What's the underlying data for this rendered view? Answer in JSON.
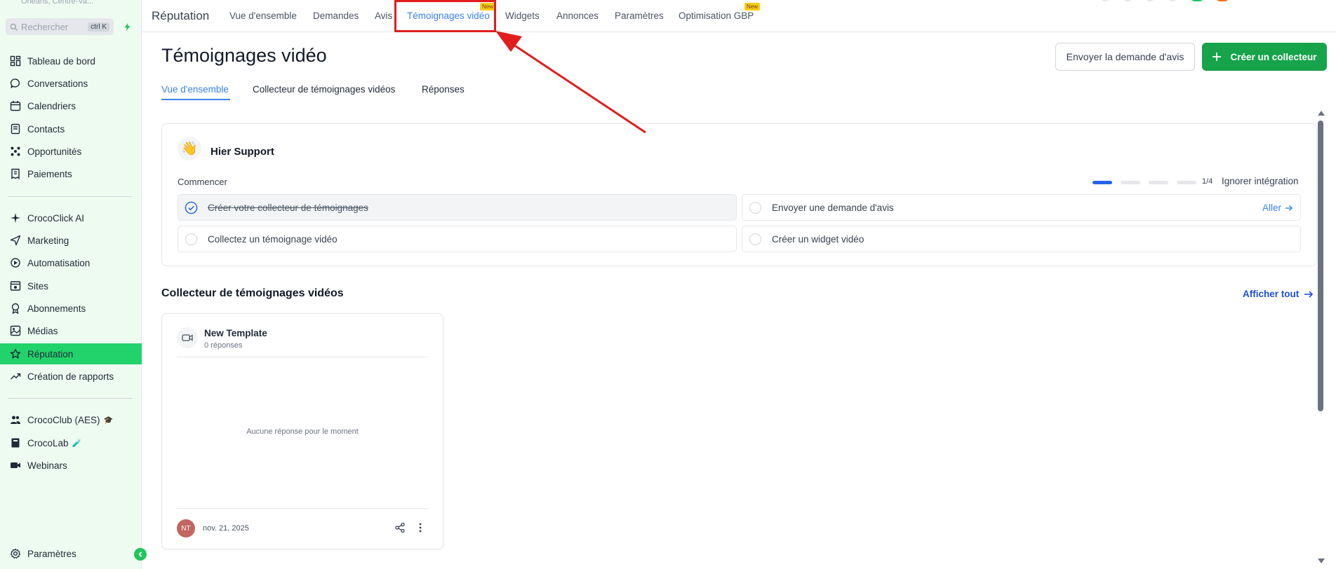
{
  "sidebar": {
    "location": "Orléans, Centre-Va...",
    "search_placeholder": "Rechercher",
    "search_shortcut": "ctrl K",
    "items": [
      {
        "label": "Tableau de bord",
        "icon": "dashboard-icon"
      },
      {
        "label": "Conversations",
        "icon": "chat-icon"
      },
      {
        "label": "Calendriers",
        "icon": "calendar-icon"
      },
      {
        "label": "Contacts",
        "icon": "contacts-icon"
      },
      {
        "label": "Opportunités",
        "icon": "pipeline-icon"
      },
      {
        "label": "Paiements",
        "icon": "receipt-icon"
      },
      {
        "label": "CrocoClick AI",
        "icon": "sparkle-icon"
      },
      {
        "label": "Marketing",
        "icon": "send-icon"
      },
      {
        "label": "Automatisation",
        "icon": "automation-icon"
      },
      {
        "label": "Sites",
        "icon": "site-icon"
      },
      {
        "label": "Abonnements",
        "icon": "award-icon"
      },
      {
        "label": "Médias",
        "icon": "image-icon"
      },
      {
        "label": "Réputation",
        "icon": "star-icon",
        "active": true
      },
      {
        "label": "Création de rapports",
        "icon": "trend-icon"
      },
      {
        "label": "CrocoClub (AES)",
        "icon": "users-icon",
        "emoji": "🎓"
      },
      {
        "label": "CrocoLab",
        "icon": "book-icon",
        "emoji": "🧪"
      },
      {
        "label": "Webinars",
        "icon": "video-icon"
      }
    ],
    "settings_label": "Paramètres"
  },
  "topnav": {
    "brand": "Réputation",
    "tabs": [
      {
        "label": "Vue d'ensemble"
      },
      {
        "label": "Demandes"
      },
      {
        "label": "Avis"
      },
      {
        "label": "Témoignages vidéo",
        "active": true,
        "badge": "New"
      },
      {
        "label": "Widgets"
      },
      {
        "label": "Annonces"
      },
      {
        "label": "Paramètres"
      },
      {
        "label": "Optimisation GBP",
        "badge": "New"
      }
    ]
  },
  "page": {
    "title": "Témoignages vidéo",
    "send_request_button": "Envoyer la demande d'avis",
    "create_collector_button": "Créer un collecteur",
    "subtabs": [
      "Vue d'ensemble",
      "Collecteur de témoignages vidéos",
      "Réponses"
    ]
  },
  "onboarding": {
    "greeting": "Hier Support",
    "start_label": "Commencer",
    "progress_text": "1/4",
    "progress_value": 0.25,
    "skip_label": "Ignorer intégration",
    "tasks": [
      {
        "label": "Créer votre collecteur de témoignages",
        "done": true
      },
      {
        "label": "Envoyer une demande d'avis",
        "done": false,
        "action": "Aller"
      },
      {
        "label": "Collectez un témoignage vidéo",
        "done": false
      },
      {
        "label": "Créer un widget vidéo",
        "done": false
      }
    ]
  },
  "collectors": {
    "section_title": "Collecteur de témoignages vidéos",
    "show_all": "Afficher tout",
    "cards": [
      {
        "name": "New Template",
        "responses": "0 réponses",
        "empty_text": "Aucune réponse pour le moment",
        "avatar_initials": "NT",
        "date": "nov. 21, 2025"
      }
    ]
  },
  "colors": {
    "accent_green": "#16a34a",
    "active_sidebar": "#22d36b",
    "link_blue": "#3b82f6",
    "annotation_red": "#e11d1d"
  }
}
